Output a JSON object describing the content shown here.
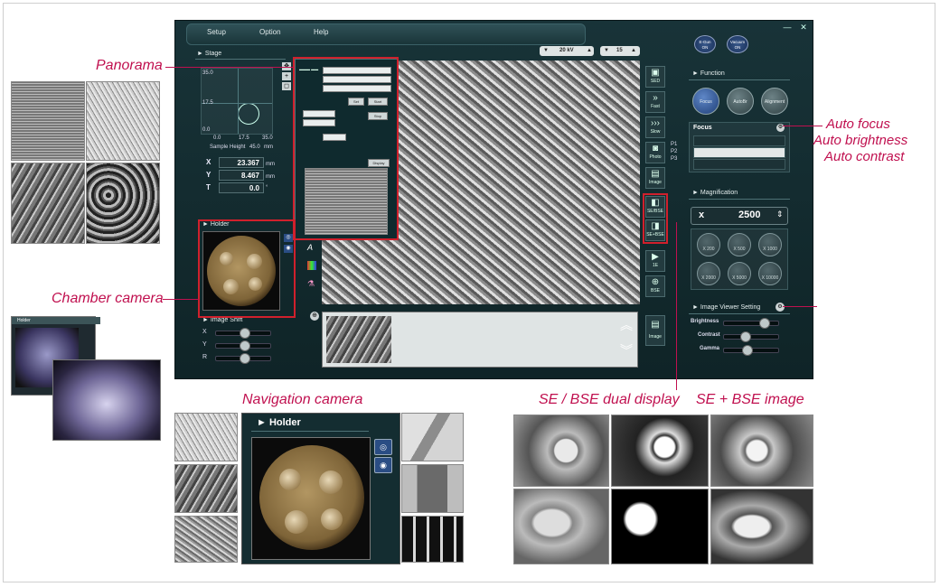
{
  "callouts": {
    "panorama": "Panorama",
    "chamber_camera": "Chamber camera",
    "navigation_camera": "Navigation camera",
    "auto_focus": "Auto focus",
    "auto_brightness": "Auto brightness",
    "auto_contrast": "Auto contrast",
    "se_bse_dual": "SE / BSE dual display",
    "se_plus_bse": "SE + BSE image"
  },
  "app": {
    "menu": [
      "Setup",
      "Option",
      "Help"
    ],
    "window_controls": [
      "—",
      "✕"
    ],
    "top_buttons": [
      {
        "label": "E-Gun",
        "state": "ON"
      },
      {
        "label": "Vacuum",
        "state": "ON"
      }
    ],
    "kv": "20 kV",
    "spot": "15",
    "stage": {
      "title": "Stage",
      "y_ticks": [
        "35.0",
        "17.5",
        "0.0"
      ],
      "x_ticks": [
        "0.0",
        "17.5",
        "35.0"
      ],
      "sample_height_label": "Sample Height",
      "sample_height_value": "45.0",
      "sample_height_unit": "mm",
      "x_label": "X",
      "x_value": "23.367",
      "x_unit": "mm",
      "y_label": "Y",
      "y_value": "8.467",
      "y_unit": "mm",
      "t_label": "T",
      "t_value": "0.0",
      "t_unit": "°"
    },
    "holder_title": "Holder",
    "image_shift": {
      "title": "Image Shift",
      "rows": [
        "X",
        "Y",
        "R"
      ]
    },
    "side_buttons": [
      "SED",
      "Fast",
      "Slow",
      "Photo",
      "Image"
    ],
    "detector_buttons": [
      "SE/BSE",
      "SE+BSE"
    ],
    "other_buttons": [
      "1E",
      "BSE"
    ],
    "presets": [
      "P1",
      "P2",
      "P3"
    ],
    "image_button": "Image",
    "function": {
      "title": "Function",
      "buttons": [
        "Focus",
        "AutoBr",
        "Alignment"
      ],
      "focus_panel_title": "Focus"
    },
    "magnification": {
      "title": "Magnification",
      "prefix": "x",
      "value": "2500",
      "presets": [
        "X 200",
        "X 500",
        "X 1000",
        "X 2000",
        "X 5000",
        "X 10000"
      ]
    },
    "image_viewer": {
      "title": "Image Viewer Setting",
      "rows": [
        {
          "label": "Brightness",
          "level": 0.78
        },
        {
          "label": "Contrast",
          "level": 0.35
        },
        {
          "label": "Gamma",
          "level": 0.4
        }
      ]
    },
    "panorama_dialog": {
      "buttons": [
        "Set",
        "Start",
        "Stop",
        "Display"
      ]
    }
  },
  "nav_holder_title": "Holder",
  "colors": {
    "accent": "#c0104f",
    "highlight": "#d0202c",
    "app_bg": "#183338"
  }
}
